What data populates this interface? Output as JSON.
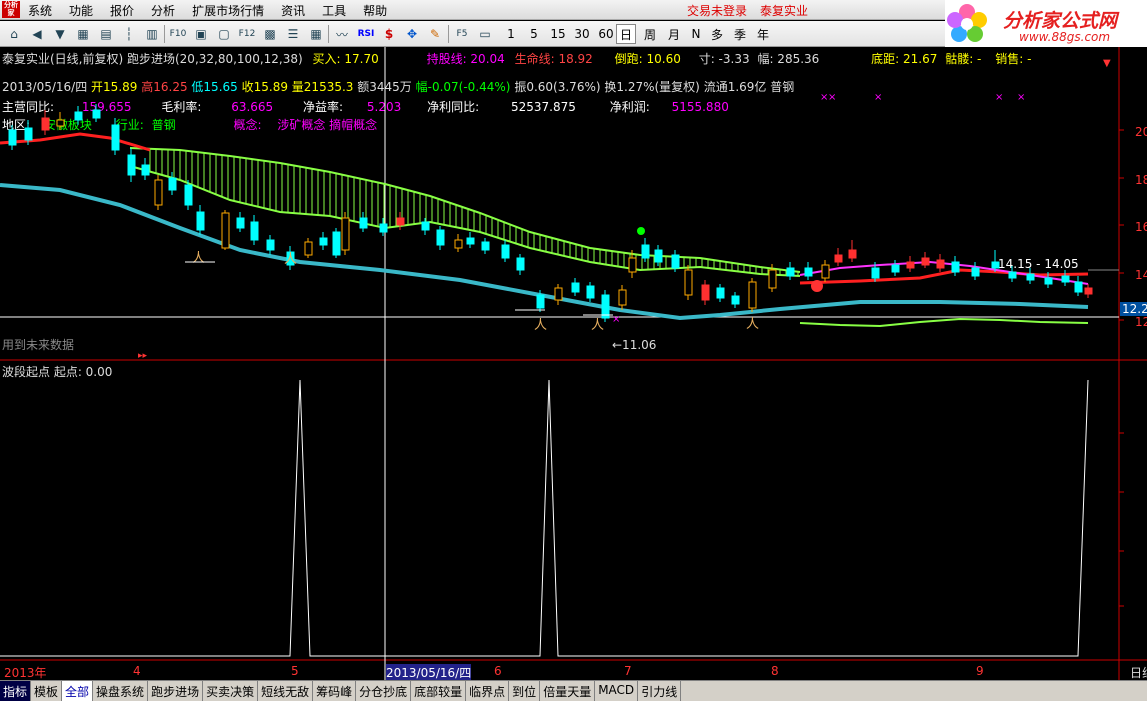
{
  "menubar": {
    "menus": [
      "系统",
      "功能",
      "报价",
      "分析",
      "扩展市场行情",
      "资讯",
      "工具",
      "帮助"
    ],
    "login_status": "交易未登录",
    "stock_name": "泰复实业"
  },
  "toolbar": {
    "periods": [
      "1",
      "5",
      "15",
      "30",
      "60",
      "日",
      "周",
      "月",
      "N",
      "多",
      "季",
      "年"
    ],
    "active_period": "日",
    "rsi_label": "RSI",
    "fs_label": "F5"
  },
  "ad": {
    "text": "分析家公式网",
    "url": "www.88gs.com"
  },
  "title_line": {
    "prefix": "泰复实业(日线,前复权) 跑步进场(20,32,80,100,12,38)",
    "buy": "买入: 17.70",
    "hold": "持股线: 20.04",
    "life": "生命线: 18.92",
    "run": "倒跑: 10.60",
    "cun": "寸: -3.33",
    "fu": "幅: 285.36",
    "bottom": "底距: 21.67",
    "hole": "骷髅: -",
    "partial": "销售: -"
  },
  "quote_line": {
    "date": "2013/05/16/四",
    "open": "开15.89",
    "high": "高16.25",
    "low": "低15.65",
    "close": "收15.89",
    "vol": "量21535.3",
    "amt": "额3445万",
    "chg": "幅-0.07(-0.44%)",
    "amp": "振0.60(3.76%)",
    "turn": "换1.27%(量复权)",
    "float": "流通1.69亿",
    "industry_short": "普钢"
  },
  "fin_line": {
    "rev_label": "主营同比:",
    "rev": "159.655",
    "margin_label": "毛利率:",
    "margin": "63.665",
    "roe_label": "净益率:",
    "roe": "5.203",
    "np_label": "净利同比:",
    "np": "52537.875",
    "net_label": "净利润:",
    "net": "5155.880"
  },
  "region_line": {
    "region_label": "地区:",
    "region": "安徽板块",
    "ind_label": "行业:",
    "ind": "普钢",
    "concept_label": "概念:",
    "concept": "涉矿概念 摘帽概念"
  },
  "future_note": "用到未来数据",
  "range_label": "14.15 - 14.05",
  "low_label": "←11.06",
  "price_axis": {
    "labels": [
      "20",
      "18",
      "16",
      "14",
      "12"
    ],
    "current": "12.20"
  },
  "lower_panel": {
    "title": "波段起点 起点: 0.00"
  },
  "x_axis": {
    "labels": [
      "2013年",
      "4",
      "5",
      "2013/05/16/四",
      "6",
      "7",
      "8",
      "9"
    ],
    "end": "日线"
  },
  "bottom_tabs": [
    "指标",
    "模板",
    "全部",
    "操盘系统",
    "跑步进场",
    "买卖决策",
    "短线无敌",
    "筹码峰",
    "分仓抄底",
    "底部较量",
    "临界点",
    "到位",
    "倍量天量",
    "MACD",
    "引力线"
  ],
  "active_tab": "全部",
  "colors": {
    "up": "#ff3030",
    "down": "#00ffff",
    "ribbon": "#88ff44",
    "life": "#ff2020",
    "blue": "#3ab8c8",
    "magenta": "#ff33ff",
    "yellow": "#ffff00",
    "white": "#ffffff"
  }
}
